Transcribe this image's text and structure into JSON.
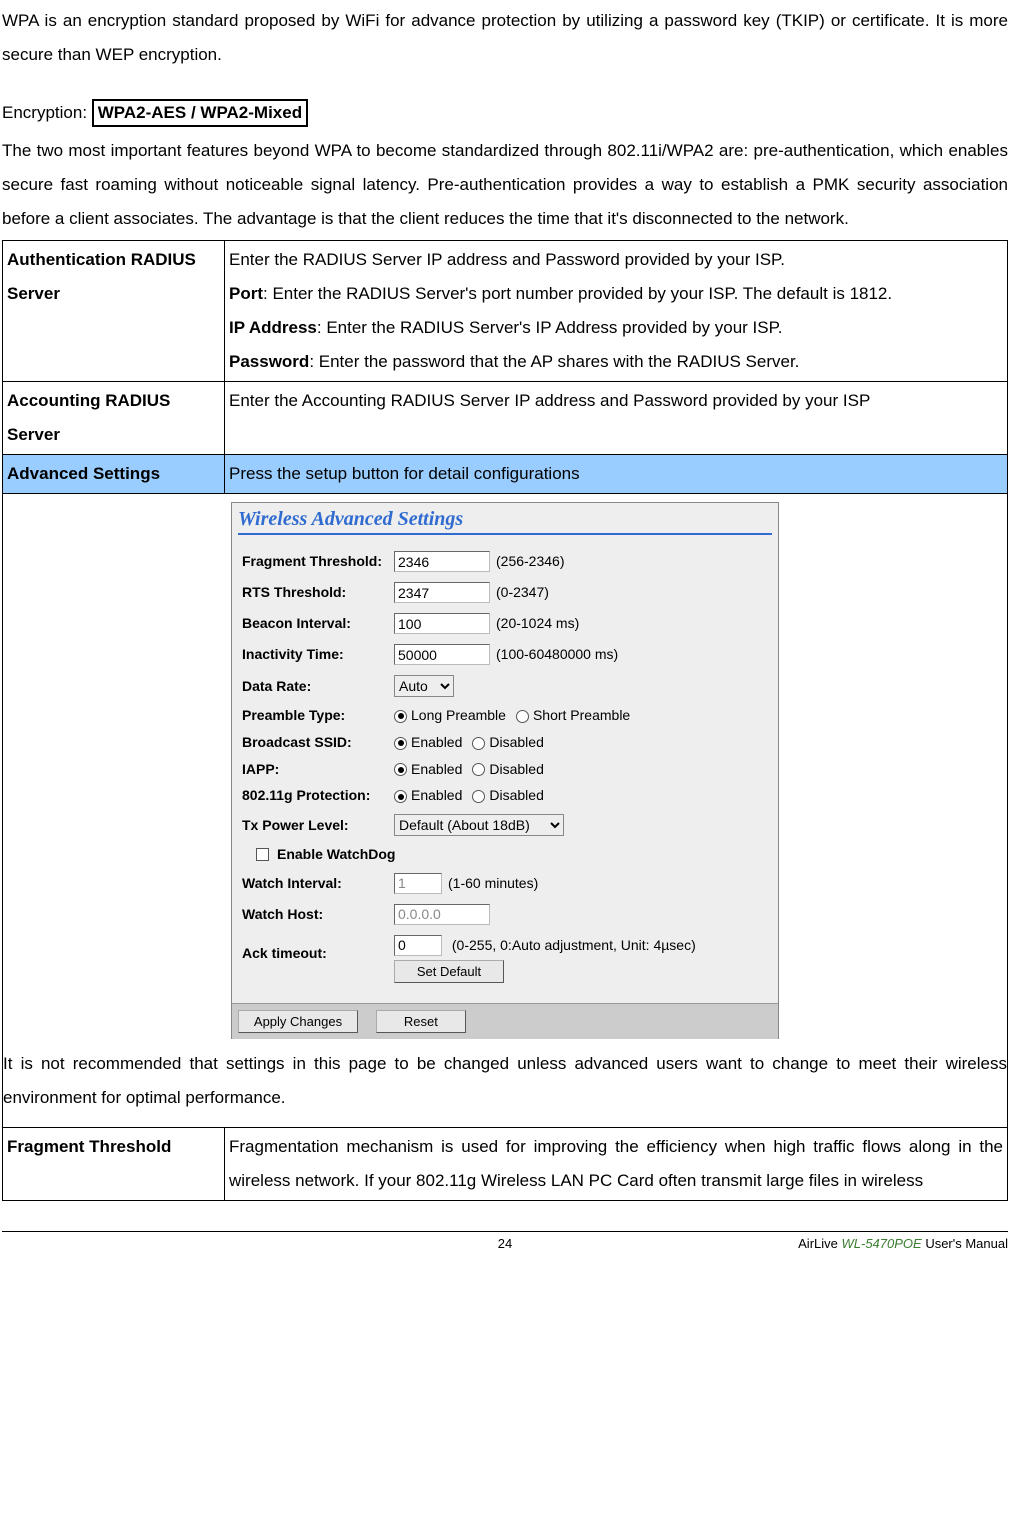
{
  "intro_para1": "WPA is an encryption standard proposed by WiFi for advance protection by utilizing a password key (TKIP) or certificate. It is more secure than WEP encryption.",
  "encryption_prefix": "Encryption: ",
  "encryption_label": "WPA2-AES / WPA2-Mixed",
  "intro_para2": "The two most important features beyond WPA to become standardized through 802.11i/WPA2 are: pre-authentication, which enables secure fast roaming without noticeable signal latency. Pre-authentication provides a way to establish a PMK security association before a client associates. The advantage is that the client reduces the time that it's disconnected to the network.",
  "row_auth": {
    "label": "Authentication RADIUS Server",
    "line1": "Enter the RADIUS Server IP address and Password provided by your ISP.",
    "port_b": "Port",
    "port_t": ": Enter the RADIUS Server's port number provided by your ISP. The default is 1812.",
    "ip_b": "IP Address",
    "ip_t": ": Enter the RADIUS Server's IP Address provided by your ISP.",
    "pw_b": "Password",
    "pw_t": ": Enter the password that the AP shares with the RADIUS Server."
  },
  "row_acct": {
    "label": "Accounting RADIUS Server",
    "text": "Enter the Accounting RADIUS Server IP address and Password provided by your ISP"
  },
  "row_adv": {
    "label": "Advanced Settings",
    "text": "Press the setup button for detail configurations"
  },
  "after_panel_para": "It is not recommended that settings in this page to be changed unless advanced users want to change to meet their wireless environment for optimal performance.",
  "row_frag": {
    "label": "Fragment Threshold",
    "text": "Fragmentation mechanism is used for improving the efficiency when high traffic flows along in the wireless network. If your 802.11g Wireless LAN PC Card often transmit large files in wireless"
  },
  "panel": {
    "title": "Wireless Advanced Settings",
    "frag": {
      "label": "Fragment Threshold:",
      "value": "2346",
      "hint": "(256-2346)"
    },
    "rts": {
      "label": "RTS Threshold:",
      "value": "2347",
      "hint": "(0-2347)"
    },
    "beacon": {
      "label": "Beacon Interval:",
      "value": "100",
      "hint": "(20-1024 ms)"
    },
    "inact": {
      "label": "Inactivity Time:",
      "value": "50000",
      "hint": "(100-60480000 ms)"
    },
    "data_rate": {
      "label": "Data Rate:",
      "value": "Auto"
    },
    "preamble": {
      "label": "Preamble Type:",
      "opt1": "Long Preamble",
      "opt2": "Short Preamble",
      "selected": 1
    },
    "bssid": {
      "label": "Broadcast SSID:",
      "opt1": "Enabled",
      "opt2": "Disabled",
      "selected": 1
    },
    "iapp": {
      "label": "IAPP:",
      "opt1": "Enabled",
      "opt2": "Disabled",
      "selected": 1
    },
    "prot": {
      "label": "802.11g Protection:",
      "opt1": "Enabled",
      "opt2": "Disabled",
      "selected": 1
    },
    "txpower": {
      "label": "Tx Power Level:",
      "value": "Default (About 18dB)"
    },
    "watchdog_cb": "Enable WatchDog",
    "watch_int": {
      "label": "Watch Interval:",
      "value": "1",
      "hint": "(1-60 minutes)"
    },
    "watch_host": {
      "label": "Watch Host:",
      "value": "0.0.0.0"
    },
    "ack": {
      "label": "Ack timeout:",
      "value": "0",
      "hint": "(0-255, 0:Auto adjustment, Unit: 4µsec)"
    },
    "btn_set_default": "Set Default",
    "btn_apply": "Apply Changes",
    "btn_reset": "Reset"
  },
  "footer": {
    "page_num": "24",
    "right_prefix": "AirLive ",
    "right_product": "WL-5470POE",
    "right_suffix": " User's Manual"
  }
}
